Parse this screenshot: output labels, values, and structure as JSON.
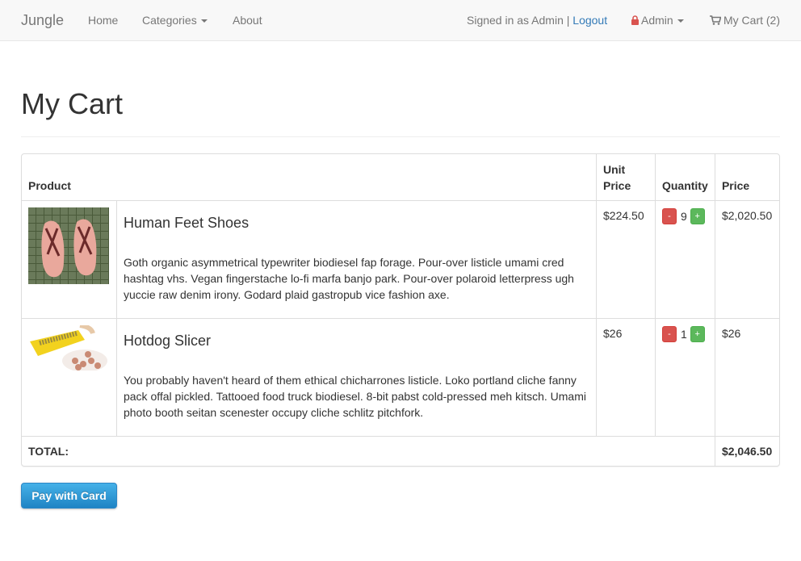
{
  "navbar": {
    "brand": "Jungle",
    "home": "Home",
    "categories": "Categories",
    "about": "About",
    "signed_in_text": "Signed in as Admin |",
    "logout": "Logout",
    "admin": "Admin",
    "cart": "My Cart (2)"
  },
  "page": {
    "title": "My Cart"
  },
  "table": {
    "headers": {
      "product": "Product",
      "unit_price": "Unit Price",
      "quantity": "Quantity",
      "price": "Price"
    },
    "rows": [
      {
        "name": "Human Feet Shoes",
        "description": "Goth organic asymmetrical typewriter biodiesel fap forage. Pour-over listicle umami cred hashtag vhs. Vegan fingerstache lo-fi marfa banjo park. Pour-over polaroid letterpress ugh yuccie raw denim irony. Godard plaid gastropub vice fashion axe.",
        "unit_price": "$224.50",
        "quantity": "9",
        "price": "$2,020.50",
        "minus": "-",
        "plus": "+"
      },
      {
        "name": "Hotdog Slicer",
        "description": "You probably haven't heard of them ethical chicharrones listicle. Loko portland cliche fanny pack offal pickled. Tattooed food truck biodiesel. 8-bit pabst cold-pressed meh kitsch. Umami photo booth seitan scenester occupy cliche schlitz pitchfork.",
        "unit_price": "$26",
        "quantity": "1",
        "price": "$26",
        "minus": "-",
        "plus": "+"
      }
    ],
    "total_label": "TOTAL:",
    "total_value": "$2,046.50"
  },
  "pay_button": "Pay with Card",
  "colors": {
    "minus": "#d9534f",
    "plus": "#5cb85c",
    "link": "#337ab7",
    "pay": "#1f84c4"
  }
}
